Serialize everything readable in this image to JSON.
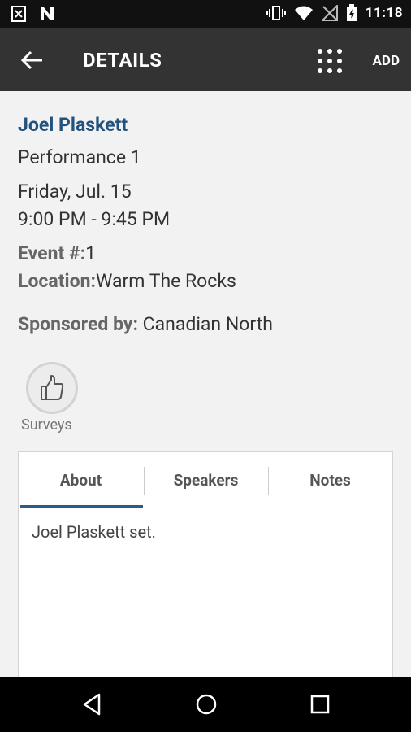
{
  "status_bar": {
    "time": "11:18"
  },
  "app_bar": {
    "title": "DETAILS",
    "add_label": "ADD"
  },
  "details": {
    "speaker_name": "Joel Plaskett",
    "session_title": "Performance 1",
    "date": "Friday, Jul. 15",
    "time_range": "9:00 PM - 9:45 PM",
    "event_label": "Event #:",
    "event_value": "1",
    "location_label": "Location:",
    "location_value": "Warm The Rocks",
    "sponsor_label": "Sponsored by:",
    "sponsor_value": " Canadian North"
  },
  "surveys": {
    "label": "Surveys",
    "icon": "thumbs-up-icon"
  },
  "tabs": {
    "items": [
      {
        "label": "About"
      },
      {
        "label": "Speakers"
      },
      {
        "label": "Notes"
      }
    ],
    "active": "About",
    "about_text": "Joel Plaskett set."
  },
  "colors": {
    "accent": "#22527e",
    "tab_underline": "#2c5b87",
    "app_bar": "#333333"
  }
}
